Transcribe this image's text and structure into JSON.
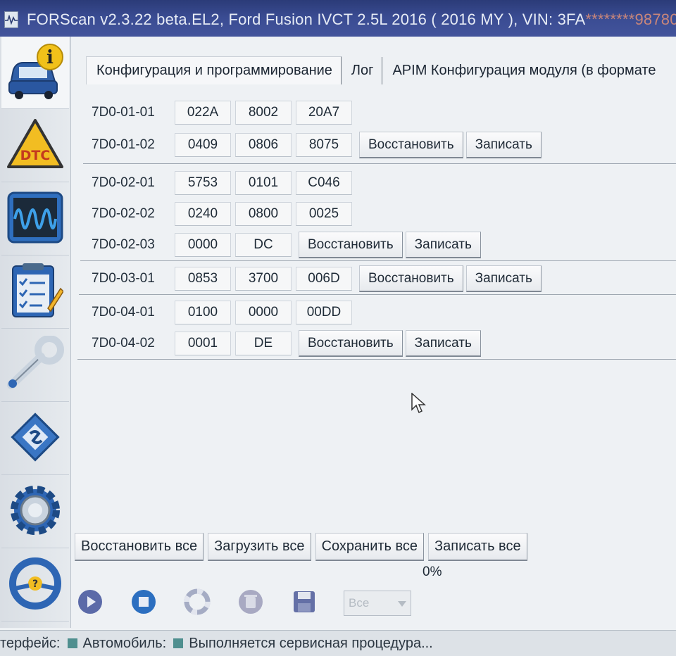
{
  "window": {
    "title": "FORScan v2.3.22 beta.EL2, Ford Fusion IVCT 2.5L 2016 ( 2016 MY ), VIN: 3FA",
    "title_vin_masked": "********98780"
  },
  "sidebar": {
    "items": [
      {
        "icon": "car-info-icon"
      },
      {
        "icon": "dtc-warning-icon"
      },
      {
        "icon": "oscilloscope-icon"
      },
      {
        "icon": "checklist-icon"
      },
      {
        "icon": "wrench-icon"
      },
      {
        "icon": "chip-module-icon"
      },
      {
        "icon": "gear-settings-icon"
      },
      {
        "icon": "steering-wheel-help-icon"
      }
    ]
  },
  "tabs": [
    {
      "label": "Конфигурация и программирование"
    },
    {
      "label": "Лог"
    },
    {
      "label": "APIM Конфигурация модуля (в формате"
    }
  ],
  "config": {
    "rows": [
      {
        "code": "7D0-01-01",
        "values": [
          "022A",
          "8002",
          "20A7"
        ]
      },
      {
        "code": "7D0-01-02",
        "values": [
          "0409",
          "0806",
          "8075"
        ]
      },
      {
        "code": "7D0-02-01",
        "values": [
          "5753",
          "0101",
          "C046"
        ]
      },
      {
        "code": "7D0-02-02",
        "values": [
          "0240",
          "0800",
          "0025"
        ]
      },
      {
        "code": "7D0-02-03",
        "values": [
          "0000",
          "DC"
        ]
      },
      {
        "code": "7D0-03-01",
        "values": [
          "0853",
          "3700",
          "006D"
        ]
      },
      {
        "code": "7D0-04-01",
        "values": [
          "0100",
          "0000",
          "00DD"
        ]
      },
      {
        "code": "7D0-04-02",
        "values": [
          "0001",
          "DE"
        ]
      }
    ],
    "restore_label": "Восстановить",
    "write_label": "Записать"
  },
  "bottom": {
    "restore_all": "Восстановить все",
    "load_all": "Загрузить все",
    "save_all": "Сохранить все",
    "write_all": "Записать все",
    "progress": "0%",
    "select_value": "Все"
  },
  "status": {
    "interface": "терфейс:",
    "vehicle": "Автомобиль:",
    "message": "Выполняется сервисная процедура..."
  },
  "colors": {
    "titlebar": "#3a4c93",
    "status_led": "#4f8f8f"
  }
}
